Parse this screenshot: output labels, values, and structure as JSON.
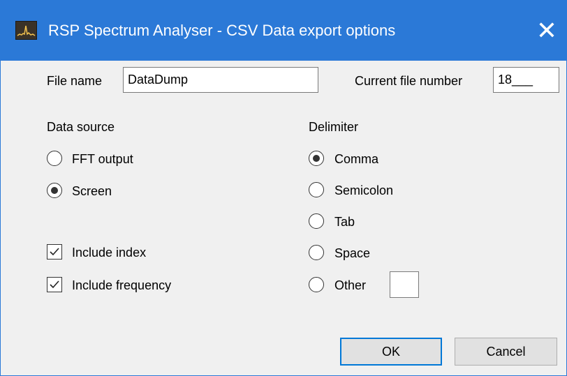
{
  "window": {
    "title": "RSP Spectrum Analyser - CSV Data export options",
    "close_glyph": "✕",
    "titlebar_color": "#2b79d7"
  },
  "file": {
    "name_label": "File name",
    "name_value": "DataDump",
    "number_label": "Current file number",
    "number_value": "18___"
  },
  "data_source": {
    "heading": "Data source",
    "options": [
      {
        "label": "FFT output",
        "selected": false
      },
      {
        "label": "Screen",
        "selected": true
      }
    ]
  },
  "options": {
    "include_index_label": "Include index",
    "include_index_checked": true,
    "include_frequency_label": "Include frequency",
    "include_frequency_checked": true
  },
  "delimiter": {
    "heading": "Delimiter",
    "options": [
      {
        "label": "Comma",
        "selected": true
      },
      {
        "label": "Semicolon",
        "selected": false
      },
      {
        "label": "Tab",
        "selected": false
      },
      {
        "label": "Space",
        "selected": false
      },
      {
        "label": "Other",
        "selected": false
      }
    ],
    "other_value": ""
  },
  "buttons": {
    "ok_label": "OK",
    "cancel_label": "Cancel"
  },
  "icons": {
    "app": "spectrum-analyser-app-icon",
    "close": "close-icon",
    "check": "checkmark-icon"
  }
}
